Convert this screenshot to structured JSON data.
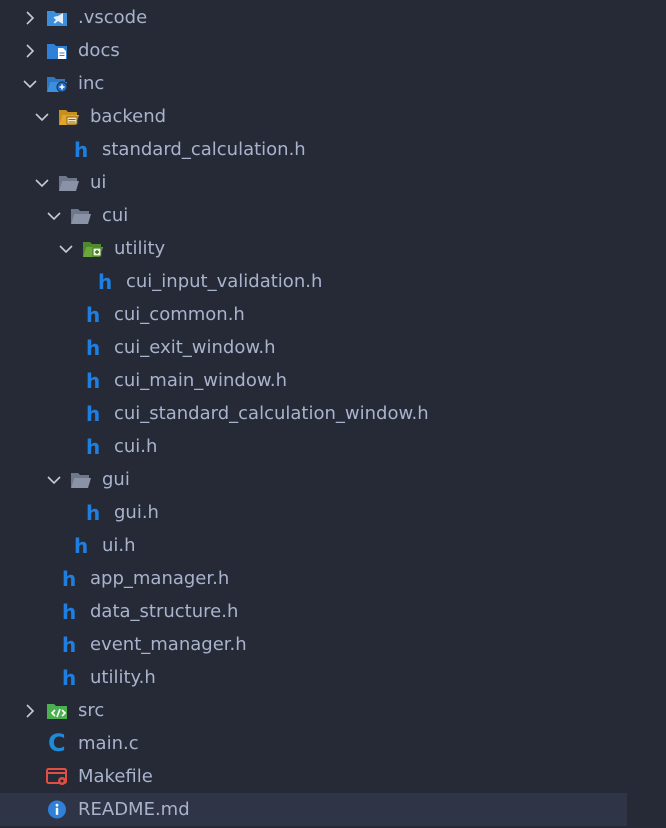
{
  "explorer": {
    "items": [
      {
        "label": ".vscode"
      },
      {
        "label": "docs"
      },
      {
        "label": "inc"
      },
      {
        "label": "backend"
      },
      {
        "label": "standard_calculation.h"
      },
      {
        "label": "ui"
      },
      {
        "label": "cui"
      },
      {
        "label": "utility"
      },
      {
        "label": "cui_input_validation.h"
      },
      {
        "label": "cui_common.h"
      },
      {
        "label": "cui_exit_window.h"
      },
      {
        "label": "cui_main_window.h"
      },
      {
        "label": "cui_standard_calculation_window.h"
      },
      {
        "label": "cui.h"
      },
      {
        "label": "gui"
      },
      {
        "label": "gui.h"
      },
      {
        "label": "ui.h"
      },
      {
        "label": "app_manager.h"
      },
      {
        "label": "data_structure.h"
      },
      {
        "label": "event_manager.h"
      },
      {
        "label": "utility.h"
      },
      {
        "label": "src"
      },
      {
        "label": "main.c"
      },
      {
        "label": "Makefile"
      },
      {
        "label": "README.md"
      }
    ],
    "glyphs": {
      "header": "h",
      "c_source": "C"
    },
    "colors": {
      "background": "#262a37",
      "selected_row": "#2f3446",
      "text": "#a9b3cc",
      "header_icon": "#1f7fe0",
      "vscode_folder": "#3b8fdc",
      "docs_folder": "#2f80d8",
      "inc_folder": "#3b8fdc",
      "backend_folder": "#e0a52a",
      "plain_folder": "#8a93a6",
      "utility_folder": "#6aa83c",
      "src_folder": "#4caf50",
      "makefile_icon": "#e24e42",
      "readme_icon": "#2f80d8"
    }
  }
}
